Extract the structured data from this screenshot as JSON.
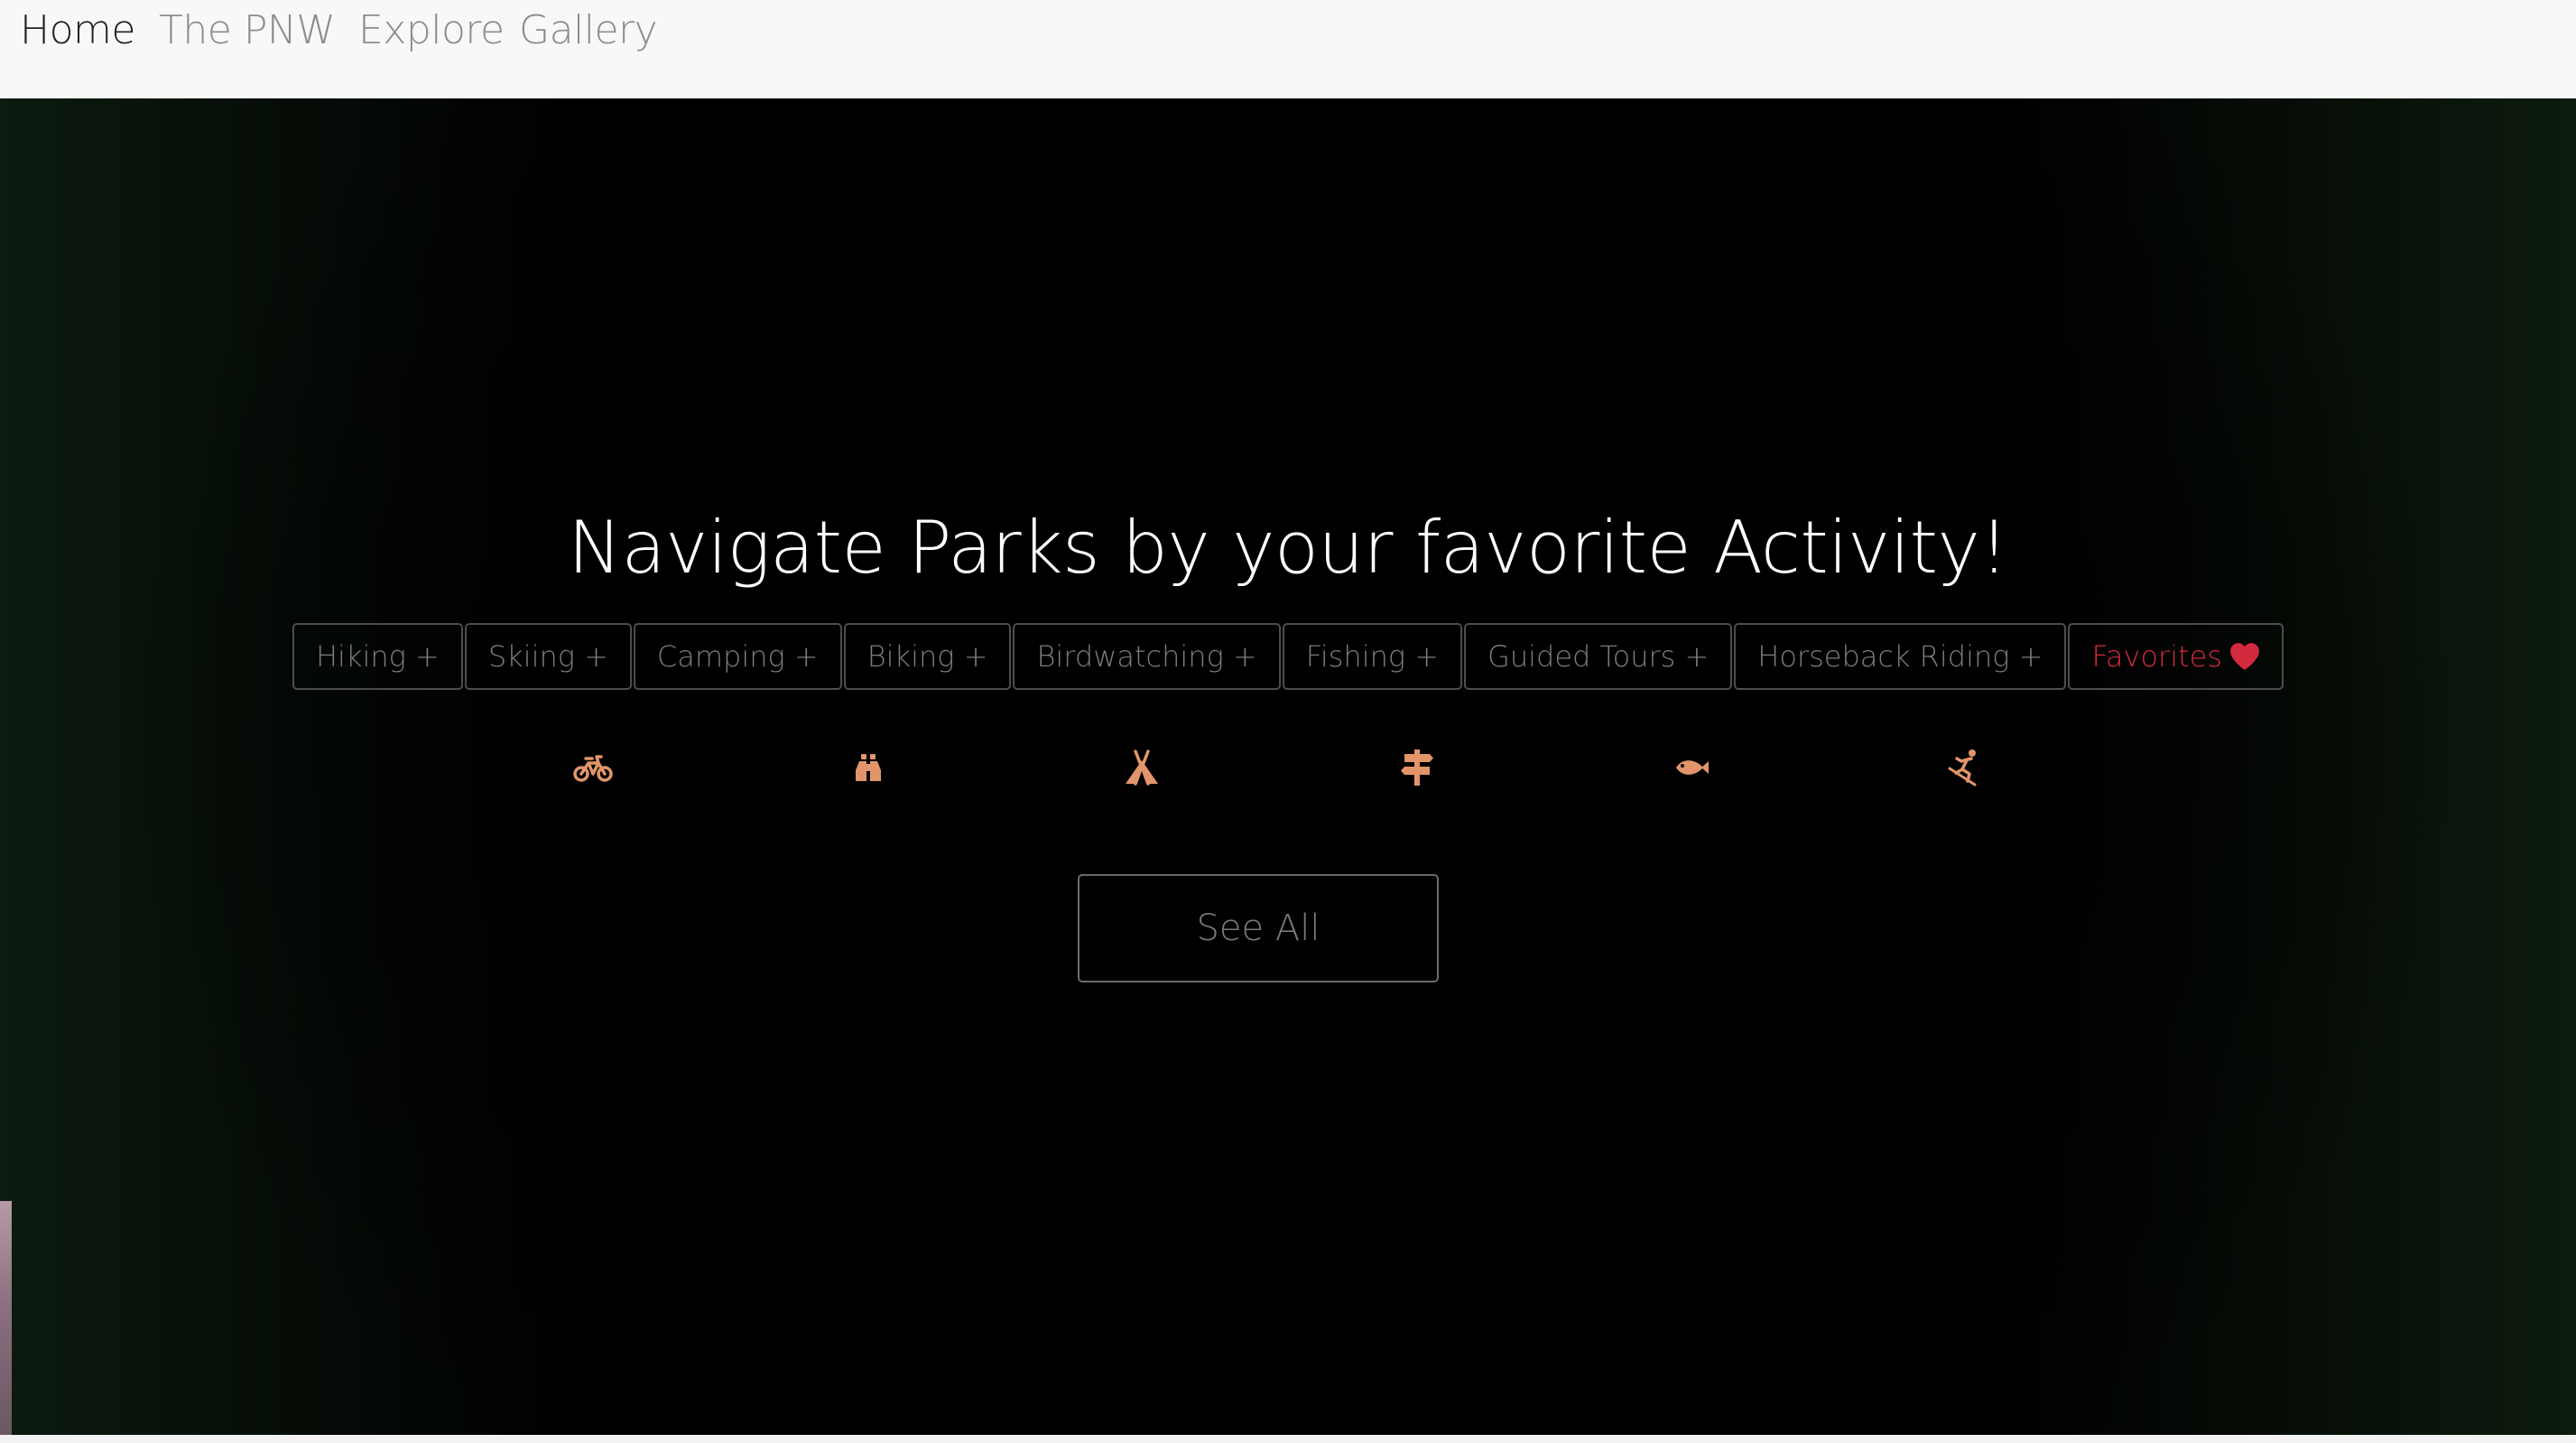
{
  "nav": {
    "items": [
      {
        "label": "Home"
      },
      {
        "label": "The PNW"
      },
      {
        "label": "Explore"
      },
      {
        "label": "Gallery"
      }
    ]
  },
  "hero": {
    "title": "Navigate Parks by your favorite Activity!"
  },
  "filters": [
    {
      "label": "Hiking +"
    },
    {
      "label": "Skiing +"
    },
    {
      "label": "Camping +"
    },
    {
      "label": "Biking +"
    },
    {
      "label": "Birdwatching +"
    },
    {
      "label": "Fishing +"
    },
    {
      "label": "Guided Tours +"
    },
    {
      "label": "Horseback Riding +"
    },
    {
      "label": "Favorites",
      "icon": "heart-icon"
    }
  ],
  "activity_icons": [
    "bicycle-icon",
    "binoculars-icon",
    "tent-icon",
    "signpost-icon",
    "fish-icon",
    "skier-icon"
  ],
  "see_all": {
    "label": "See All"
  },
  "colors": {
    "nav_bg": "#f7f8fa",
    "nav_active": "#222222",
    "nav_inactive": "#8c8c8c",
    "hero_bg": "#000000",
    "accent_icon": "#e2956a",
    "favorites": "#d42a3e",
    "button_border": "#4d4d4d"
  }
}
